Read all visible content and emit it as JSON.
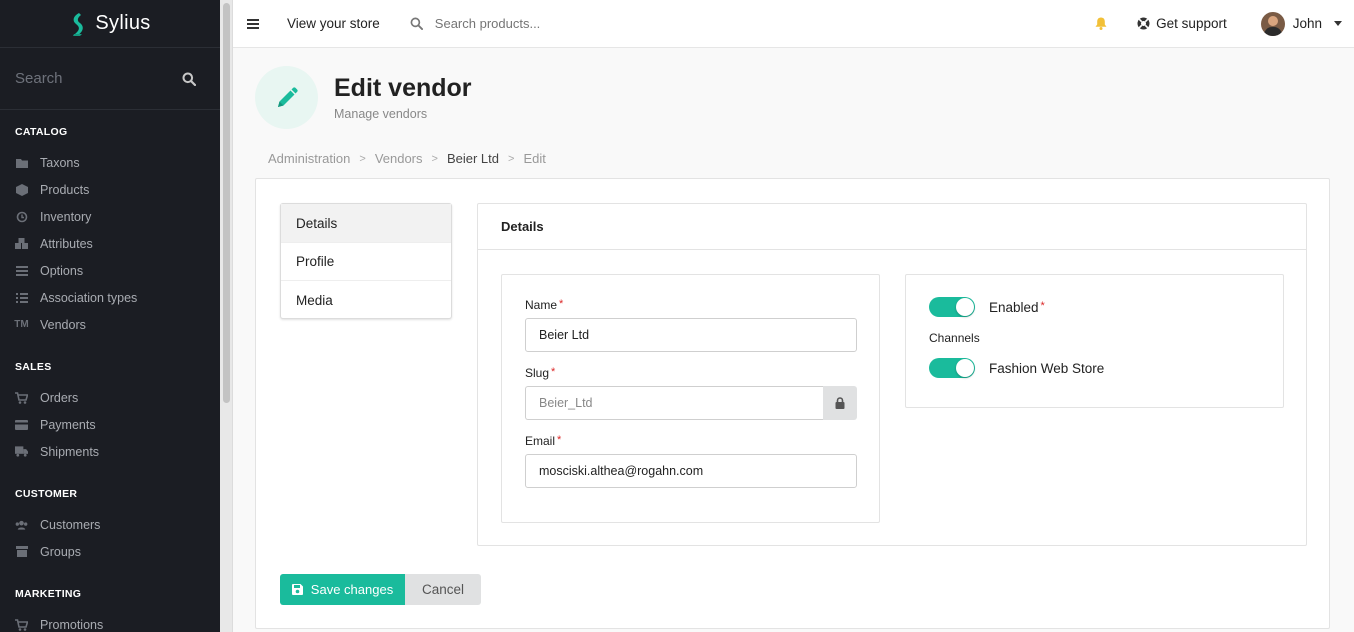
{
  "brand": {
    "name": "Sylius",
    "accent": "#1abb9c"
  },
  "sidebar": {
    "search_placeholder": "Search",
    "sections": [
      {
        "heading": "CATALOG",
        "items": [
          {
            "label": "Taxons",
            "icon": "folder-icon"
          },
          {
            "label": "Products",
            "icon": "cube-icon"
          },
          {
            "label": "Inventory",
            "icon": "history-icon"
          },
          {
            "label": "Attributes",
            "icon": "cubes-icon"
          },
          {
            "label": "Options",
            "icon": "options-icon"
          },
          {
            "label": "Association types",
            "icon": "tasks-icon"
          },
          {
            "label": "Vendors",
            "icon": "trademark-icon"
          }
        ]
      },
      {
        "heading": "SALES",
        "items": [
          {
            "label": "Orders",
            "icon": "cart-icon"
          },
          {
            "label": "Payments",
            "icon": "payment-icon"
          },
          {
            "label": "Shipments",
            "icon": "truck-icon"
          }
        ]
      },
      {
        "heading": "CUSTOMER",
        "items": [
          {
            "label": "Customers",
            "icon": "users-icon"
          },
          {
            "label": "Groups",
            "icon": "archive-icon"
          }
        ]
      },
      {
        "heading": "MARKETING",
        "items": [
          {
            "label": "Promotions",
            "icon": "cart-icon"
          }
        ]
      }
    ]
  },
  "topbar": {
    "view_store": "View your store",
    "search_placeholder": "Search products...",
    "support": "Get support",
    "user_name": "John"
  },
  "header": {
    "title": "Edit vendor",
    "subtitle": "Manage vendors"
  },
  "breadcrumb": [
    "Administration",
    "Vendors",
    "Beier Ltd",
    "Edit"
  ],
  "tabs": [
    "Details",
    "Profile",
    "Media"
  ],
  "panel": {
    "title": "Details",
    "name_label": "Name",
    "name_value": "Beier Ltd",
    "slug_label": "Slug",
    "slug_value": "Beier_Ltd",
    "email_label": "Email",
    "email_value": "mosciski.althea@rogahn.com",
    "enabled_label": "Enabled",
    "channels_label": "Channels",
    "channel_name": "Fashion Web Store",
    "required_mark": "*"
  },
  "actions": {
    "save": "Save changes",
    "cancel": "Cancel"
  }
}
